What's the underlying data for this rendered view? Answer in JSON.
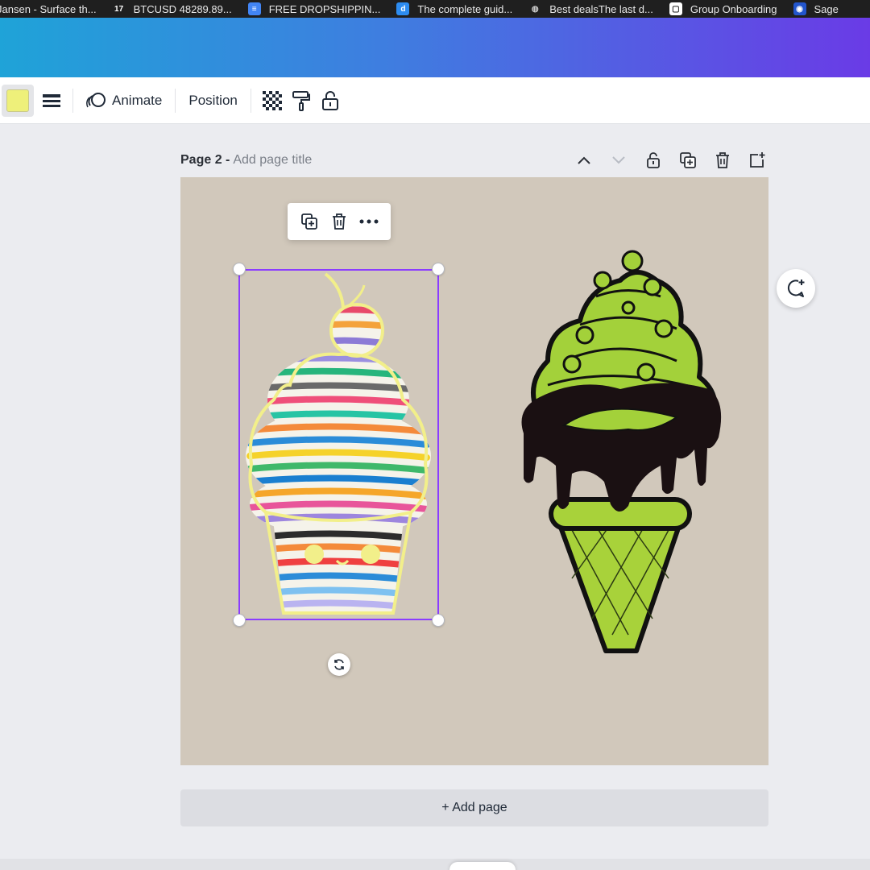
{
  "bookmarks": [
    {
      "icon": "tab-partial-icon",
      "label": "Jansen - Surface th..."
    },
    {
      "icon": "tradingview-icon",
      "label": "BTCUSD 48289.89..."
    },
    {
      "icon": "google-doc-icon",
      "label": "FREE DROPSHIPPIN..."
    },
    {
      "icon": "doc-blue-icon",
      "label": "The complete guid..."
    },
    {
      "icon": "globe-icon",
      "label": "Best dealsThe last d..."
    },
    {
      "icon": "group-icon",
      "label": "Group Onboarding"
    },
    {
      "icon": "sage-icon",
      "label": "Sage"
    }
  ],
  "toolbar": {
    "color_swatch": "#eef07a",
    "animate_label": "Animate",
    "position_label": "Position"
  },
  "page": {
    "title_label": "Page 2 -",
    "title_placeholder": "Add page title"
  },
  "canvas": {
    "background": "#d1c8bb",
    "elements": [
      "rainbow-striped-ice-cream-illustration",
      "lime-ice-cream-cone-illustration"
    ]
  },
  "add_page_label": "+ Add page"
}
